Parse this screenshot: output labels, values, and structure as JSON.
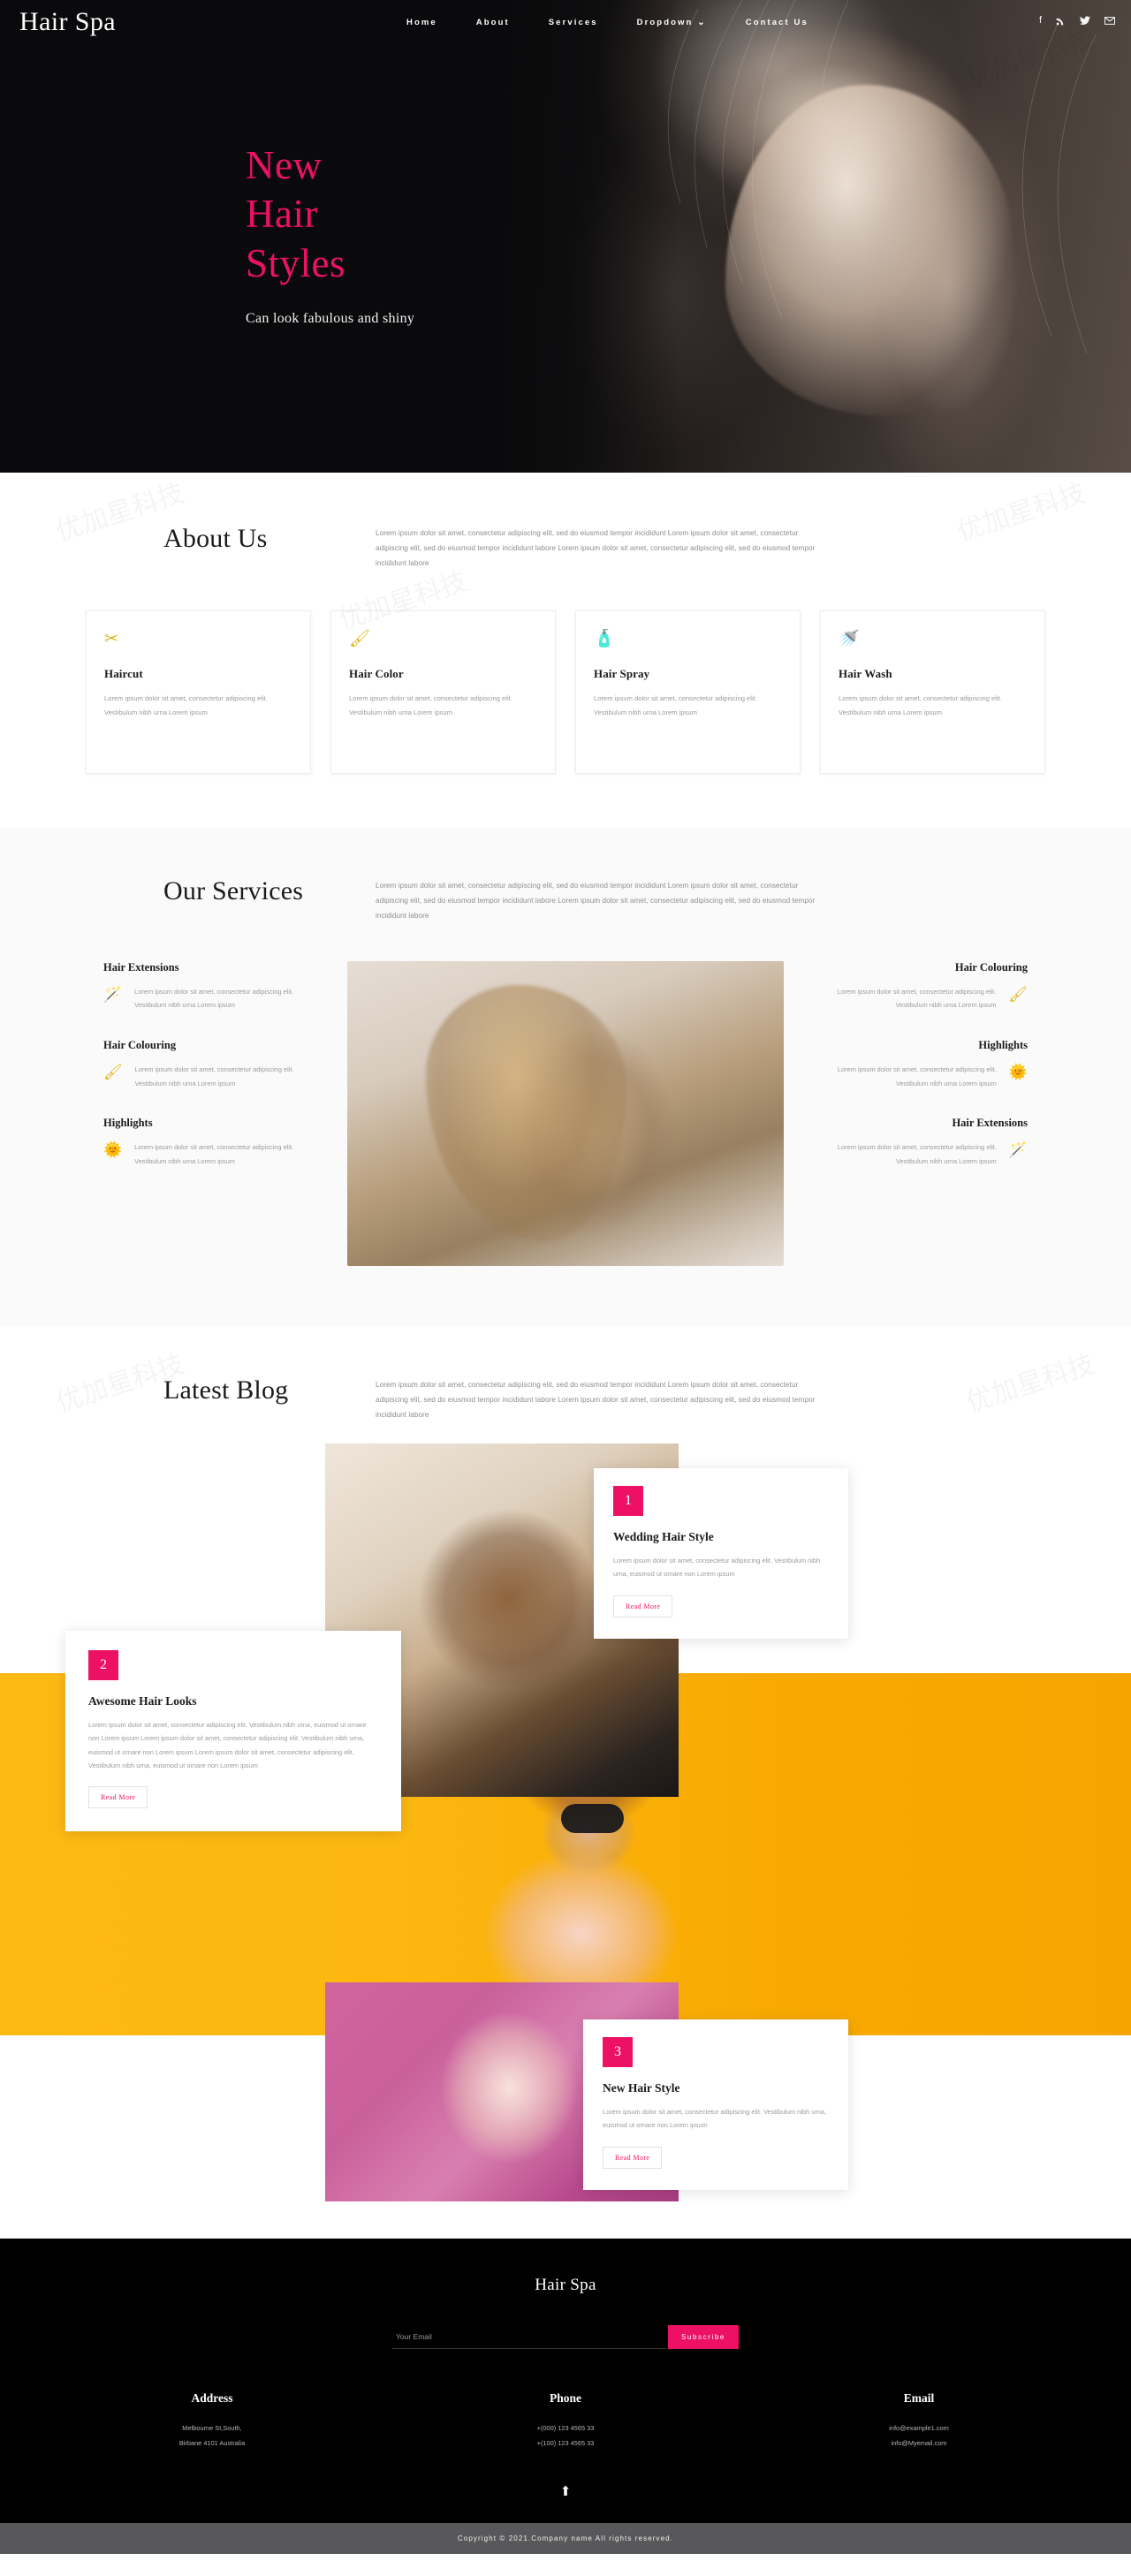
{
  "brand": "Hair Spa",
  "nav": {
    "links": [
      {
        "label": "Home"
      },
      {
        "label": "About"
      },
      {
        "label": "Services"
      },
      {
        "label": "Dropdown"
      },
      {
        "label": "Contact Us"
      }
    ],
    "social": [
      {
        "name": "facebook-icon",
        "glyph": "f"
      },
      {
        "name": "rss-icon",
        "glyph": "☲"
      },
      {
        "name": "twitter-icon",
        "glyph": "ᴠ"
      },
      {
        "name": "email-icon",
        "glyph": "✉"
      }
    ]
  },
  "hero": {
    "title_line1": "New",
    "title_line2": "Hair",
    "title_line3": "Styles",
    "subtitle": "Can look fabulous and shiny",
    "accent_color": "#ed1165"
  },
  "about": {
    "title": "About Us",
    "text": "Lorem ipsum dolor sit amet, consectetur adipiscing elit, sed do eiusmod tempor incididunt Lorem ipsum dolor sit amet, consectetur adipiscing elit, sed do eiusmod tempor incididunt labore Lorem ipsum dolor sit amet, consectetur adipiscing elit, sed do eiusmod tempor incididunt labore",
    "cards": [
      {
        "icon": "✂",
        "icon_name": "scissors-icon",
        "title": "Haircut",
        "text": "Lorem ipsum dolor sit amet, consectetur adipiscing elit. Vestibulum nibh urna Lorem ipsum"
      },
      {
        "icon": "🖌",
        "icon_name": "brush-icon",
        "title": "Hair Color",
        "text": "Lorem ipsum dolor sit amet, consectetur adipiscing elit. Vestibulum nibh urna Lorem ipsum"
      },
      {
        "icon": "🧴",
        "icon_name": "spray-icon",
        "title": "Hair Spray",
        "text": "Lorem ipsum dolor sit amet, consectetur adipiscing elit. Vestibulum nibh urna Lorem ipsum"
      },
      {
        "icon": "🚿",
        "icon_name": "shower-icon",
        "title": "Hair Wash",
        "text": "Lorem ipsum dolor sit amet, consectetur adipiscing elit. Vestibulum nibh urna Lorem ipsum"
      }
    ]
  },
  "services": {
    "title": "Our Services",
    "text": "Lorem ipsum dolor sit amet, consectetur adipiscing elit, sed do eiusmod tempor incididunt Lorem ipsum dolor sit amet, consectetur adipiscing elit, sed do eiusmod tempor incididunt labore Lorem ipsum dolor sit amet, consectetur adipiscing elit, sed do eiusmod tempor incididunt labore",
    "body": "Lorem ipsum dolor sit amet, consectetur adipiscing elit. Vestibulum nibh urna Lorem ipsum",
    "left": [
      {
        "title": "Hair Extensions",
        "icon": "🪄",
        "icon_name": "wand-icon"
      },
      {
        "title": "Hair Colouring",
        "icon": "🖌",
        "icon_name": "brush-icon"
      },
      {
        "title": "Highlights",
        "icon": "🌞",
        "icon_name": "highlights-icon"
      }
    ],
    "right": [
      {
        "title": "Hair Colouring",
        "icon": "🖌",
        "icon_name": "brush-icon"
      },
      {
        "title": "Highlights",
        "icon": "🌞",
        "icon_name": "highlights-icon"
      },
      {
        "title": "Hair Extensions",
        "icon": "🪄",
        "icon_name": "wand-icon"
      }
    ]
  },
  "blog": {
    "title": "Latest Blog",
    "text": "Lorem ipsum dolor sit amet, consectetur adipiscing elit, sed do eiusmod tempor incididunt Lorem ipsum dolor sit amet, consectetur adipiscing elit, sed do eiusmod tempor incididunt labore Lorem ipsum dolor sit amet, consectetur adipiscing elit, sed do eiusmod tempor incididunt labore",
    "posts": [
      {
        "number": "1",
        "title": "Wedding Hair Style",
        "text": "Lorem ipsum dolor sit amet, consectetur adipiscing elit. Vestibulum nibh urna, euismod ut ornare non Lorem ipsum",
        "button": "Read More"
      },
      {
        "number": "2",
        "title": "Awesome Hair Looks",
        "text": "Lorem ipsum dolor sit amet, consectetur adipiscing elit. Vestibulum nibh urna, euismod ut ornare non Lorem ipsum Lorem ipsum dolor sit amet, consectetur adipiscing elit. Vestibulum nibh urna, euismod ut ornare non Lorem ipsum Lorem ipsum dolor sit amet, consectetur adipiscing elit. Vestibulum nibh urna, euismod ut ornare non Lorem ipsum",
        "button": "Read More"
      },
      {
        "number": "3",
        "title": "New Hair Style",
        "text": "Lorem ipsum dolor sit amet, consectetur adipiscing elit. Vestibulum nibh urna, euismod ut ornare non Lorem ipsum",
        "button": "Read More"
      }
    ]
  },
  "footer": {
    "brand": "Hair Spa",
    "email_placeholder": "Your Email",
    "subscribe_label": "Subscribe",
    "columns": [
      {
        "heading": "Address",
        "line1": "Melbourne St,South,",
        "line2": "Birbane 4101 Australia"
      },
      {
        "heading": "Phone",
        "line1": "+(000) 123 4565 33",
        "line2": "+(100) 123 4565 33"
      },
      {
        "heading": "Email",
        "line1": "info@example1.com",
        "line2": "info@Myemail.com"
      }
    ],
    "to_top_icon": "⬆",
    "copyright": "Copyright © 2021.Company name All rights reserved."
  }
}
